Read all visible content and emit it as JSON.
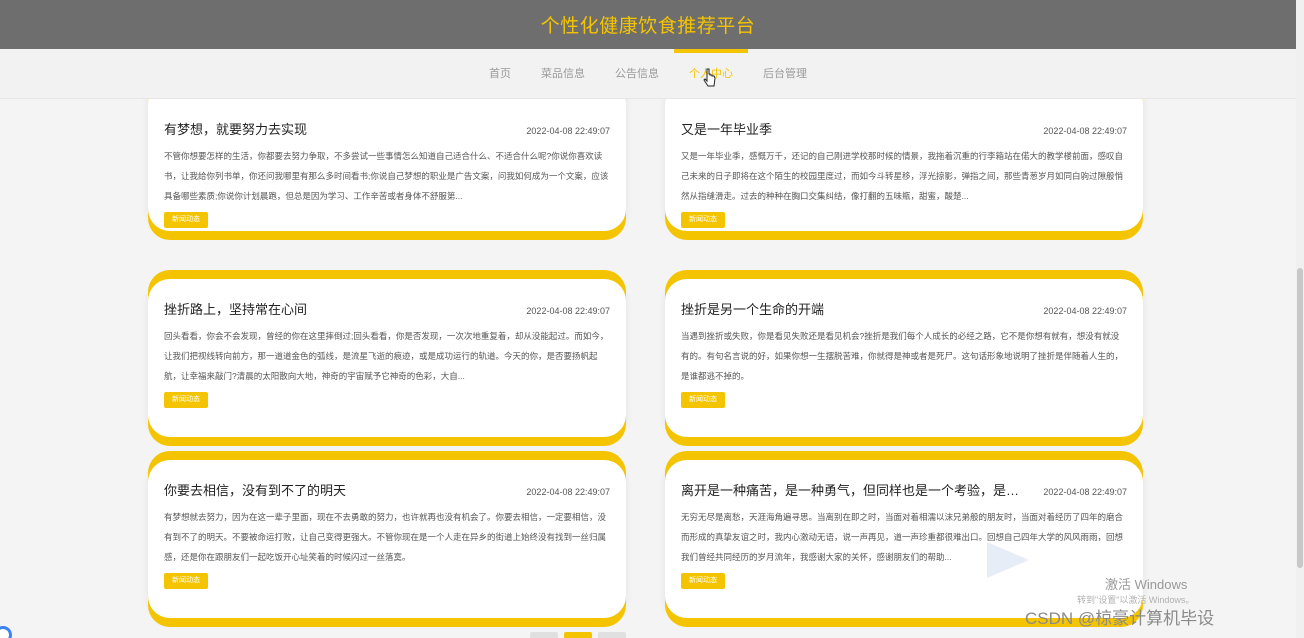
{
  "header": {
    "title": "个性化健康饮食推荐平台"
  },
  "nav": {
    "items": [
      {
        "label": "首页"
      },
      {
        "label": "菜品信息"
      },
      {
        "label": "公告信息"
      },
      {
        "label": "个人中心"
      },
      {
        "label": "后台管理"
      }
    ],
    "active_index": 3
  },
  "cards": [
    {
      "title": "有梦想，就要努力去实现",
      "date": "2022-04-08 22:49:07",
      "text": "不管你想要怎样的生活，你都要去努力争取，不多尝试一些事情怎么知道自己适合什么、不适合什么呢?你说你喜欢读书，让我给你列书单，你还问我哪里有那么多时间看书;你说自己梦想的职业是广告文案，问我如何成为一个文案，应该具备哪些素质;你说你计划晨跑，但总是因为学习、工作辛苦或者身体不舒服第...",
      "tag": "新闻动态"
    },
    {
      "title": "又是一年毕业季",
      "date": "2022-04-08 22:49:07",
      "text": "又是一年毕业季，感慨万千，还记的自己刚进学校那时候的情景，我拖着沉重的行李箱站在偌大的教学楼前面，感叹自己未来的日子即将在这个陌生的校园里度过，而如今斗转星移，浮光掠影，弹指之间，那些青葱岁月如同白驹过隙般悄然从指缝滑走。过去的种种在胸口交集纠结，像打翻的五味瓶，甜蜜，酸楚...",
      "tag": "新闻动态"
    },
    {
      "title": "挫折路上，坚持常在心间",
      "date": "2022-04-08 22:49:07",
      "text": "回头看看，你会不会发现，曾经的你在这里摔倒过;回头看看，你是否发现，一次次地重复着，却从没能起过。而如今，让我们把视线转向前方，那一道道金色的弧线，是流星飞逝的痕迹，或是成功运行的轨道。今天的你，是否要扬帆起航，让幸福来敲门?清晨的太阳散向大地，神奇的宇宙赋予它神奇的色彩，大自...",
      "tag": "新闻动态"
    },
    {
      "title": "挫折是另一个生命的开端",
      "date": "2022-04-08 22:49:07",
      "text": "当遇到挫折或失败，你是看见失败还是看见机会?挫折是我们每个人成长的必经之路，它不是你想有就有，想没有就没有的。有句名言说的好，如果你想一生摆脱苦难，你就得是神或者是死尸。这句话形象地说明了挫折是伴随着人生的，是谁都逃不掉的。",
      "tag": "新闻动态"
    },
    {
      "title": "你要去相信，没有到不了的明天",
      "date": "2022-04-08 22:49:07",
      "text": "有梦想就去努力，因为在这一辈子里面，现在不去勇敢的努力，也许就再也没有机会了。你要去相信，一定要相信，没有到不了的明天。不要被命运打败，让自己变得更强大。不管你现在是一个人走在异乡的街道上始终没有找到一丝归属感，还是你在跟朋友们一起吃饭开心址笑着的时候闪过一丝落寞。",
      "tag": "新闻动态"
    },
    {
      "title": "离开是一种痛苦，是一种勇气，但同样也是一个考验，是一个新的开端",
      "date": "2022-04-08 22:49:07",
      "text": "无穷无尽是离愁，天涯海角遍寻思。当离别在即之时，当面对着相濡以沫兄弟般的朋友时，当面对着经历了四年的磨合而形成的真挚友谊之时，我内心激动无语，说一声再见，道一声珍重都很难出口。回想自己四年大学的风风雨雨，回想我们曾经共同经历的岁月流年，我感谢大家的关怀，感谢朋友们的帮助...",
      "tag": "新闻动态"
    }
  ],
  "overlay": {
    "windows_activate": "激活 Windows",
    "windows_activate_sub": "转到\"设置\"以激活 Windows。",
    "csdn_watermark": "CSDN @椋豪计算机毕设"
  }
}
